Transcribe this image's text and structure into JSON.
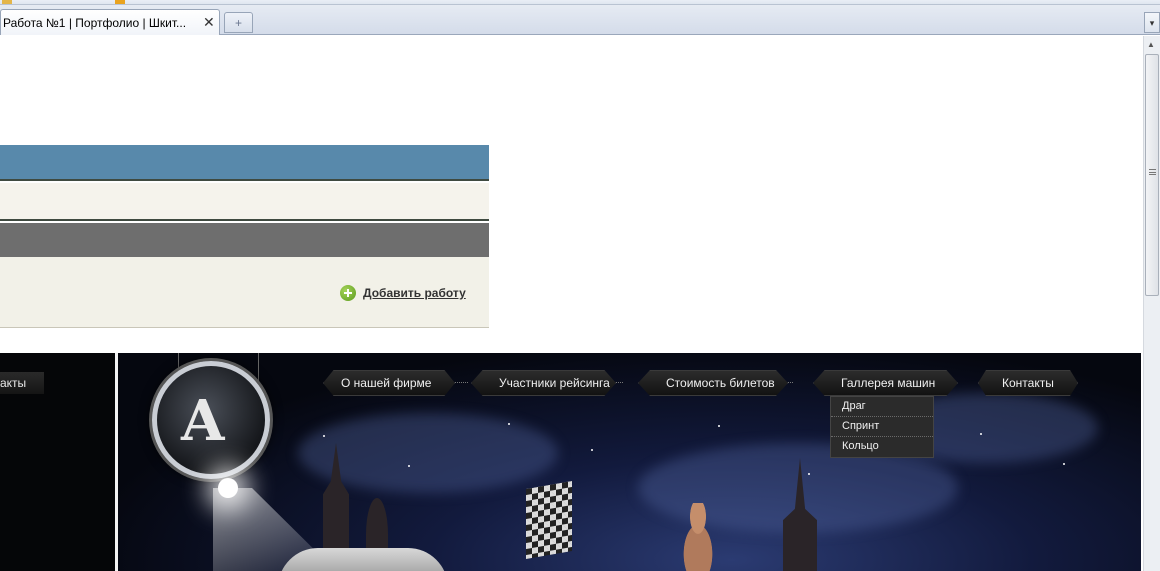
{
  "browser": {
    "tab_title": "Работа №1 | Портфолио | Шкит...",
    "tab_close_glyph": "✕",
    "new_tab_glyph": "+",
    "tab_list_glyph": "▾",
    "scroll_up_glyph": "▲"
  },
  "page": {
    "add_work_label": "Добавить работу",
    "colors": {
      "blue_band": "#5889ab",
      "cream_band": "#f5f3ec",
      "gray_band": "#6e6e6e",
      "light_band": "#f2f1e8"
    }
  },
  "site": {
    "left_nav_label": "акты",
    "logo_glyph": "A",
    "nav": [
      {
        "label": "О нашей фирме"
      },
      {
        "label": "Участники рейсинга"
      },
      {
        "label": "Стоимость билетов"
      },
      {
        "label": "Галлерея машин"
      },
      {
        "label": "Контакты"
      }
    ],
    "dropdown": [
      {
        "label": "Драг"
      },
      {
        "label": "Спринт"
      },
      {
        "label": "Кольцо"
      }
    ]
  }
}
